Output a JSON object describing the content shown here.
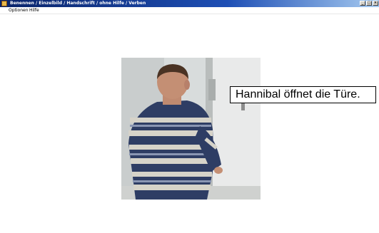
{
  "window": {
    "title": "Benennen / Einzelbild / Handschrift / ohne Hilfe / Verben",
    "icon": "app-icon",
    "controls": {
      "minimize": "_",
      "maximize": "□",
      "close": "×"
    }
  },
  "menu": {
    "items": [
      {
        "label": "Optionen"
      },
      {
        "label": "Hilfe"
      }
    ]
  },
  "exercise": {
    "image": "photo-man-opening-door",
    "caption": "Hannibal öffnet die Türe."
  },
  "colors": {
    "titlebar_start": "#0a246a",
    "titlebar_end": "#a6caf0",
    "background": "#ffffff"
  }
}
